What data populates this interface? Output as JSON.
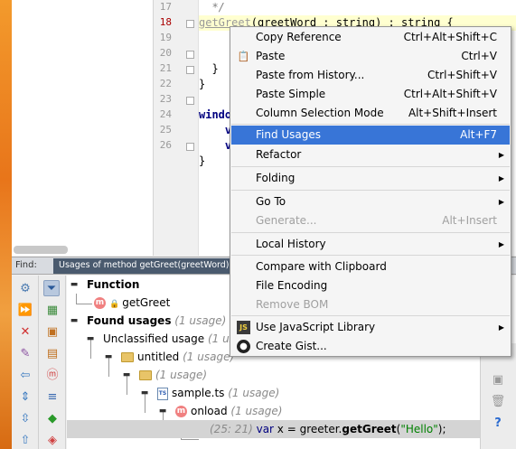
{
  "editor": {
    "lines": [
      {
        "num": "17",
        "text": "  */"
      },
      {
        "num": "18",
        "pre": "",
        "fn": "getGreet",
        "post": "(greetWord : string) : string {"
      },
      {
        "num": "19",
        "text": ""
      },
      {
        "num": "20",
        "text": "  }"
      },
      {
        "num": "21",
        "text": "}"
      },
      {
        "num": "22",
        "text": ""
      },
      {
        "num": "23",
        "text": "windo"
      },
      {
        "num": "24",
        "text": "    va"
      },
      {
        "num": "25",
        "text": "    va"
      },
      {
        "num": "26",
        "text": "}"
      }
    ]
  },
  "context_menu": {
    "items": [
      {
        "label": "Copy Reference",
        "shortcut": "Ctrl+Alt+Shift+C"
      },
      {
        "label": "Paste",
        "shortcut": "Ctrl+V",
        "icon": "paste-icon"
      },
      {
        "label": "Paste from History...",
        "shortcut": "Ctrl+Shift+V"
      },
      {
        "label": "Paste Simple",
        "shortcut": "Ctrl+Alt+Shift+V"
      },
      {
        "label": "Column Selection Mode",
        "shortcut": "Alt+Shift+Insert"
      },
      {
        "label": "Find Usages",
        "shortcut": "Alt+F7",
        "selected": true
      },
      {
        "label": "Refactor",
        "submenu": true
      },
      {
        "label": "Folding",
        "submenu": true
      },
      {
        "label": "Go To",
        "submenu": true
      },
      {
        "label": "Generate...",
        "shortcut": "Alt+Insert",
        "disabled": true
      },
      {
        "label": "Local History",
        "submenu": true
      },
      {
        "label": "Compare with Clipboard"
      },
      {
        "label": "File Encoding"
      },
      {
        "label": "Remove BOM",
        "disabled": true
      },
      {
        "label": "Use JavaScript Library",
        "submenu": true,
        "icon": "js-library-icon"
      },
      {
        "label": "Create Gist...",
        "icon": "github-icon"
      }
    ]
  },
  "find_panel": {
    "label": "Find:",
    "tab_title": "Usages of method getGreet(greetWord) in Proj",
    "tree": {
      "function_header": "Function",
      "function_name": "getGreet",
      "found_usages": "Found usages",
      "found_count": "(1 usage)",
      "unclassified": "Unclassified usage",
      "unclassified_count": "(1 us",
      "folder_untitled": "untitled",
      "untitled_count": "(1 usage)",
      "subfolder_count": "(1 usage)",
      "file": "sample.ts",
      "file_count": "(1 usage)",
      "method": "onload",
      "method_count": "(1 usage)",
      "usage_pos": "(25: 21)",
      "usage_kw": "var",
      "usage_pre": " x = greeter.",
      "usage_fn": "getGreet",
      "usage_paren_open": "(",
      "usage_str": "\"Hello\"",
      "usage_post": ");"
    }
  },
  "colors": {
    "selection": "#3875d7",
    "tab_active": "#4a5a6e",
    "method_icon": "#f08080"
  }
}
